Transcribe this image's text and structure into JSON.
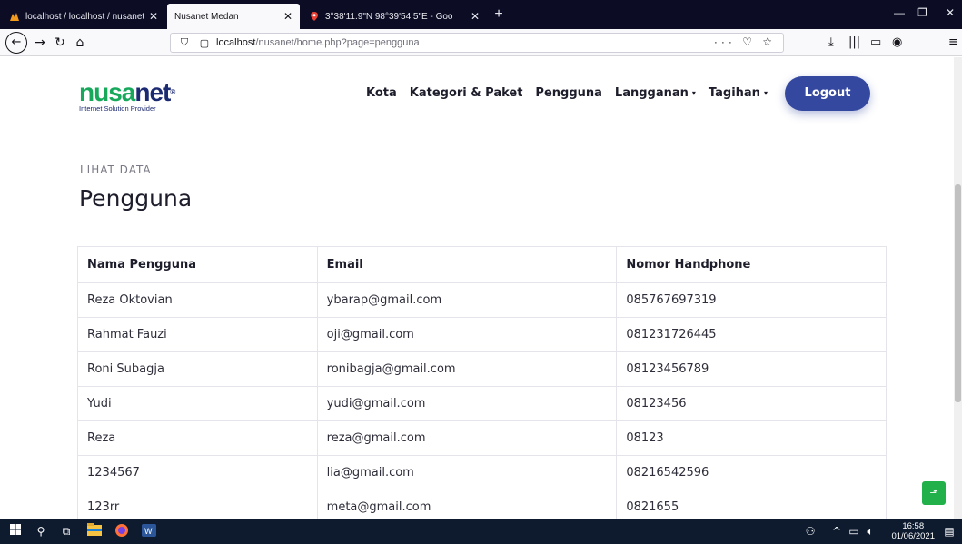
{
  "browser": {
    "tabs": [
      {
        "title": "localhost / localhost / nusanet",
        "active": false
      },
      {
        "title": "Nusanet Medan",
        "active": true
      },
      {
        "title": "3°38'11.9\"N 98°39'54.5\"E - Goo",
        "active": false
      }
    ],
    "new_tab": "+",
    "url_host": "localhost",
    "url_path": "/nusanet/home.php?page=pengguna",
    "url_actions": "··· ♡ ☆"
  },
  "site": {
    "logo_green": "nusa",
    "logo_blue": "net",
    "logo_reg": "®",
    "logo_tagline": "Internet Solution Provider",
    "nav": [
      {
        "label": "Kota",
        "caret": false
      },
      {
        "label": "Kategori & Paket",
        "caret": false
      },
      {
        "label": "Pengguna",
        "caret": false
      },
      {
        "label": "Langganan",
        "caret": true
      },
      {
        "label": "Tagihan",
        "caret": true
      }
    ],
    "logout_label": "Logout"
  },
  "main": {
    "kicker": "LIHAT DATA",
    "title": "Pengguna",
    "table": {
      "headers": [
        "Nama Pengguna",
        "Email",
        "Nomor Handphone"
      ],
      "rows": [
        [
          "Reza Oktovian",
          "ybarap@gmail.com",
          "085767697319"
        ],
        [
          "Rahmat Fauzi",
          "oji@gmail.com",
          "081231726445"
        ],
        [
          "Roni Subagja",
          "ronibagja@gmail.com",
          "08123456789"
        ],
        [
          "Yudi",
          "yudi@gmail.com",
          "08123456"
        ],
        [
          "Reza",
          "reza@gmail.com",
          "08123"
        ],
        [
          "1234567",
          "lia@gmail.com",
          "08216542596"
        ],
        [
          "123rr",
          "meta@gmail.com",
          "0821655"
        ]
      ]
    }
  },
  "taskbar": {
    "time": "16:58",
    "date": "01/06/2021"
  },
  "colors": {
    "brand_green": "#17a85b",
    "brand_blue": "#1c2a72",
    "logout_bg": "#3548a0",
    "to_top_bg": "#22b04b"
  }
}
